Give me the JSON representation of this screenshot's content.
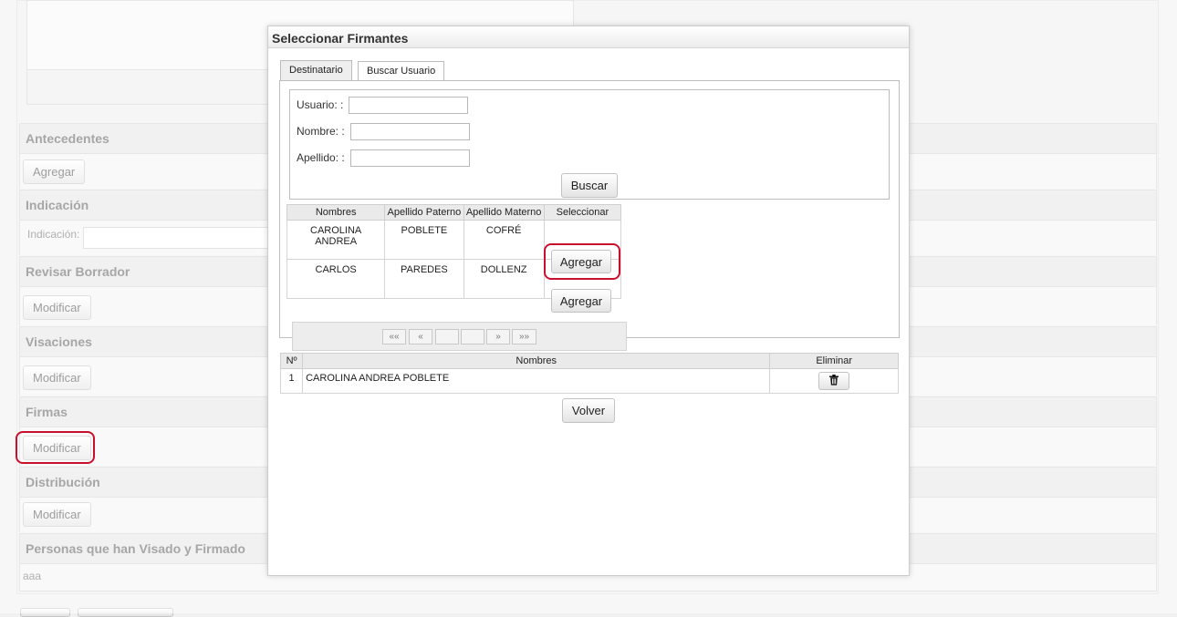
{
  "background": {
    "sections": [
      {
        "title": "Antecedentes",
        "button": "Agregar"
      },
      {
        "title": "Indicación",
        "field_label": "Indicación:"
      },
      {
        "title": "Revisar Borrador",
        "button": "Modificar"
      },
      {
        "title": "Visaciones",
        "button": "Modificar"
      },
      {
        "title": "Firmas",
        "button": "Modificar"
      },
      {
        "title": "Distribución",
        "button": "Modificar"
      },
      {
        "title": "Personas que han Visado y Firmado",
        "text": "aaa"
      }
    ]
  },
  "dialog": {
    "title": "Seleccionar Firmantes",
    "tabs": [
      {
        "label": "Destinatario"
      },
      {
        "label": "Buscar Usuario"
      }
    ],
    "form": {
      "usuario_label": "Usuario: :",
      "nombre_label": "Nombre: :",
      "apellido_label": "Apellido: :",
      "usuario_value": "",
      "nombre_value": "",
      "apellido_value": "",
      "buscar_label": "Buscar"
    },
    "results": {
      "headers": [
        "Nombres",
        "Apellido Paterno",
        "Apellido Materno",
        "Seleccionar"
      ],
      "rows": [
        {
          "nombres": "CAROLINA ANDREA",
          "paterno": "POBLETE",
          "materno": "COFRÉ",
          "action": "Agregar"
        },
        {
          "nombres": "CARLOS",
          "paterno": "PAREDES",
          "materno": "DOLLENZ",
          "action": "Agregar"
        }
      ],
      "pager": {
        "first": "««",
        "prev": "«",
        "next": "»",
        "last": "»»"
      }
    },
    "selected": {
      "headers": [
        "Nº",
        "Nombres",
        "Eliminar"
      ],
      "rows": [
        {
          "num": "1",
          "nombres": "CAROLINA ANDREA POBLETE"
        }
      ]
    },
    "volver_label": "Volver"
  },
  "accent": {
    "highlight": "#c8102e"
  }
}
